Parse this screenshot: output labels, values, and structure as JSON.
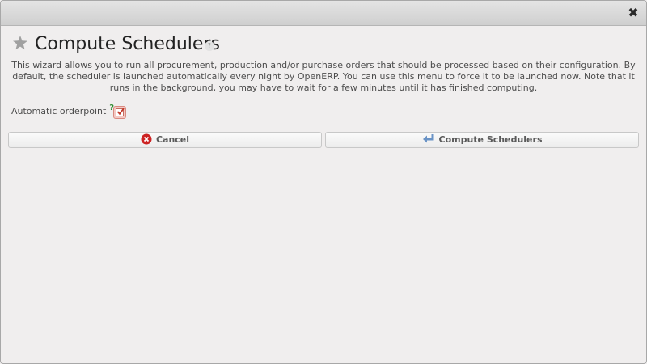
{
  "dialog": {
    "title": "Compute Schedulers",
    "title_help": "?",
    "close_icon": "close-icon",
    "description": "This wizard allows you to run all procurement, production and/or purchase orders that should be processed based on their configuration. By default, the scheduler is launched automatically every night by OpenERP. You can use this menu to force it to be launched now. Note that it runs in the background, you may have to wait for a few minutes until it has finished computing."
  },
  "form": {
    "automatic_orderpoint": {
      "label": "Automatic orderpoint",
      "help": "?",
      "colon": ":",
      "checked": true
    }
  },
  "buttons": {
    "cancel": {
      "label": "Cancel",
      "icon": "cancel-circle-icon"
    },
    "compute": {
      "label": "Compute Schedulers",
      "icon": "return-arrow-icon"
    }
  },
  "colors": {
    "background": "#f0eeee",
    "titlebar": "#cfcfcf",
    "cancel_icon": "#cc2222",
    "compute_icon": "#6a93c6",
    "help_green": "#2e8b2e"
  }
}
